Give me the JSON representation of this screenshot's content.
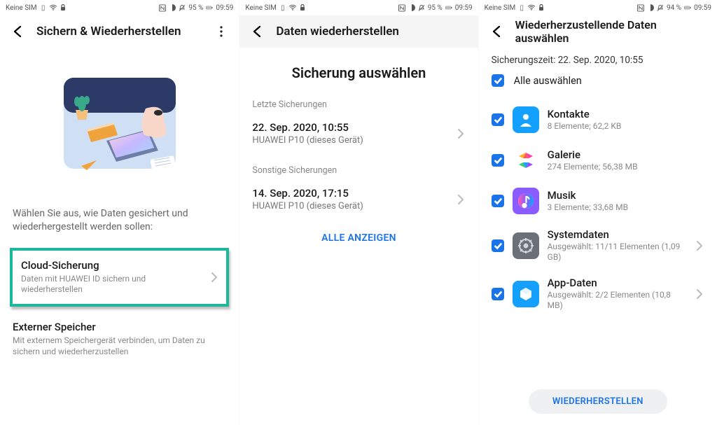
{
  "status": {
    "sim": "Keine SIM",
    "battery_a": "95 %",
    "battery_b": "95 %",
    "battery_c": "94 %",
    "time": "09:59"
  },
  "panel1": {
    "title": "Sichern & Wiederherstellen",
    "prompt": "Wählen Sie aus, wie Daten gesichert und wiederhergestellt werden sollen:",
    "opt1_title": "Cloud-Sicherung",
    "opt1_sub": "Daten mit HUAWEI ID sichern und wiederherstellen",
    "opt2_title": "Externer Speicher",
    "opt2_sub": "Mit externem Speichergerät verbinden, um Daten zu sichern und wiederherzustellen"
  },
  "panel2": {
    "title": "Daten wiederherstellen",
    "heading": "Sicherung auswählen",
    "recent_label": "Letzte Sicherungen",
    "recent_date": "22. Sep. 2020, 10:55",
    "recent_dev": "HUAWEI P10 (dieses Gerät)",
    "other_label": "Sonstige Sicherungen",
    "other_date": "14. Sep. 2020, 17:15",
    "other_dev": "HUAWEI P10 (dieses Gerät)",
    "show_all": "ALLE ANZEIGEN"
  },
  "panel3": {
    "title": "Wiederherzustellende Daten auswählen",
    "ts_line": "Sicherungszeit: 22. Sep. 2020, 10:55",
    "sel_all": "Alle auswählen",
    "items": {
      "contacts_name": "Kontakte",
      "contacts_meta": "8 Elemente; 62,2 KB",
      "gallery_name": "Galerie",
      "gallery_meta": "274 Elemente; 56,38 MB",
      "music_name": "Musik",
      "music_meta": "3 Elemente; 33,68 MB",
      "system_name": "Systemdaten",
      "system_meta": "Ausgewählt: 11/11 Elementen (1,09 GB)",
      "appdata_name": "App-Daten",
      "appdata_meta": "Ausgewählt: 2/2 Elementen (10,8 MB)"
    },
    "restore_btn": "WIEDERHERSTELLEN"
  }
}
